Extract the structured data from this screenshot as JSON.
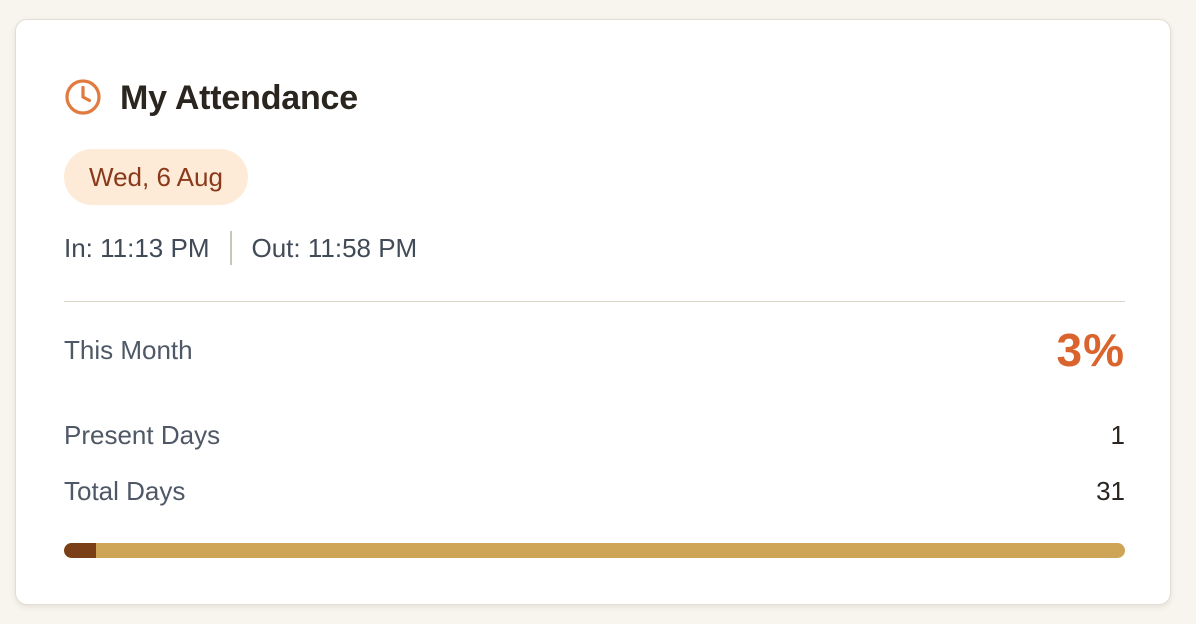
{
  "card": {
    "title": "My Attendance",
    "icon": "clock-icon",
    "accent_color": "#e07a3f"
  },
  "today": {
    "date": "Wed, 6 Aug",
    "check_in": "In: 11:13 PM",
    "check_out": "Out: 11:58 PM"
  },
  "month": {
    "label": "This Month",
    "percent": "3%",
    "present_label": "Present Days",
    "present_value": "1",
    "total_label": "Total Days",
    "total_value": "31",
    "progress_fraction": 0.03
  },
  "colors": {
    "percent": "#d9642e",
    "progress_fill": "#7a3f17",
    "progress_track": "#cea457",
    "date_pill_bg": "#fdebd7",
    "date_pill_text": "#8a3a1c"
  }
}
